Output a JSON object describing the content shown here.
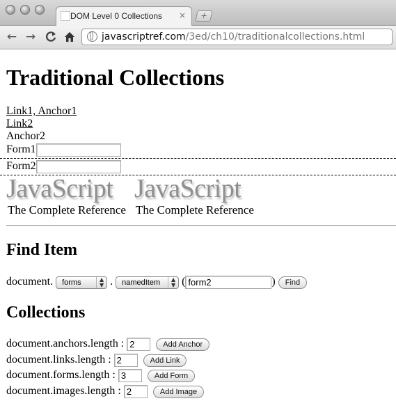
{
  "browser": {
    "tab_title": "DOM Level 0 Collections",
    "tab_close": "×",
    "new_tab": "+",
    "url_host": "javascriptref.com",
    "url_path": "/3ed/ch10/traditionalcollections.html",
    "back_icon": "←",
    "forward_icon": "→",
    "reload_icon": "C",
    "home_icon": "home"
  },
  "page": {
    "title": "Traditional Collections",
    "link1": "Link1, Anchor1",
    "link2": "Link2",
    "anchor2": "Anchor2",
    "form1_label": "Form1",
    "form1_value": "",
    "form2_label": "Form2",
    "form2_value": "",
    "logo_main": "JavaScript",
    "logo_sub": "The Complete Reference",
    "find": {
      "heading": "Find Item",
      "prefix": "document.",
      "collection_value": "forms",
      "dot": ".",
      "method_value": "namedItem",
      "paren_open": "(",
      "arg_value": "form2",
      "paren_close": ")",
      "button": "Find"
    },
    "collections": {
      "heading": "Collections",
      "rows": [
        {
          "label": "document.anchors.length :",
          "value": "2",
          "button": "Add Anchor"
        },
        {
          "label": "document.links.length :",
          "value": "2",
          "button": "Add Link"
        },
        {
          "label": "document.forms.length :",
          "value": "3",
          "button": "Add Form"
        },
        {
          "label": "document.images.length :",
          "value": "2",
          "button": "Add Image"
        }
      ]
    }
  }
}
